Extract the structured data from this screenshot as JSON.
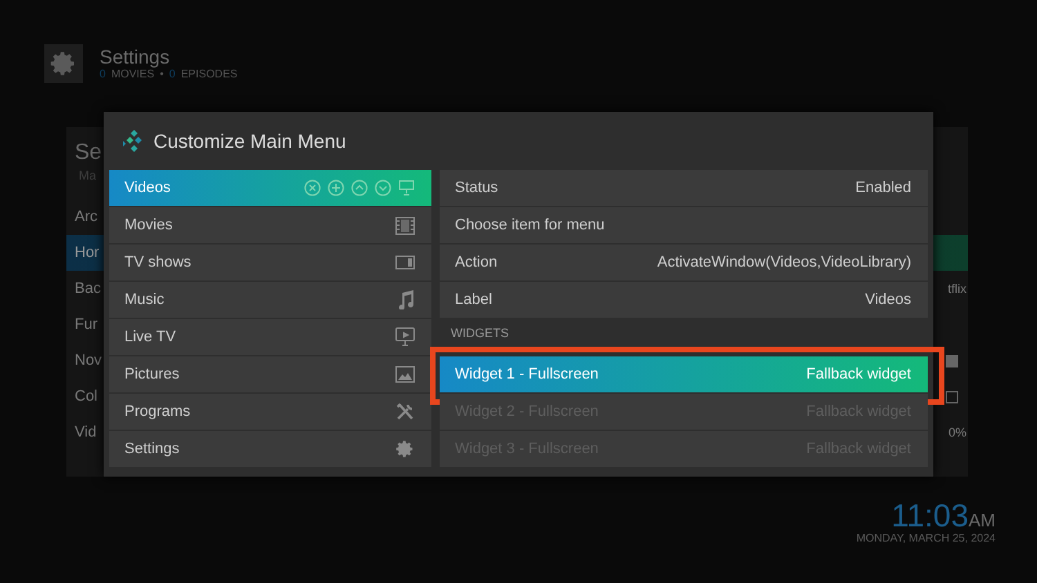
{
  "header": {
    "title": "Settings",
    "counts": [
      {
        "count": "0",
        "label": "MOVIES"
      },
      {
        "count": "0",
        "label": "EPISODES"
      }
    ],
    "separator": "•"
  },
  "background_panel": {
    "title": "Se",
    "subtitle": "Ma",
    "rows": [
      {
        "label": "Arc",
        "selected": false
      },
      {
        "label": "Hor",
        "selected": true
      },
      {
        "label": "Bac",
        "selected": false,
        "kind": "text",
        "value": "tflix"
      },
      {
        "label": "Fur",
        "selected": false
      },
      {
        "label": "Nov",
        "selected": false,
        "kind": "checkbox",
        "checked": true
      },
      {
        "label": "Col",
        "selected": false,
        "kind": "checkbox",
        "checked": false
      },
      {
        "label": "Vid",
        "selected": false,
        "kind": "text",
        "value": "0%"
      }
    ]
  },
  "dialog": {
    "title": "Customize Main Menu",
    "menu_items": [
      {
        "label": "Videos",
        "selected": true
      },
      {
        "label": "Movies",
        "selected": false
      },
      {
        "label": "TV shows",
        "selected": false
      },
      {
        "label": "Music",
        "selected": false
      },
      {
        "label": "Live TV",
        "selected": false
      },
      {
        "label": "Pictures",
        "selected": false
      },
      {
        "label": "Programs",
        "selected": false
      },
      {
        "label": "Settings",
        "selected": false
      }
    ],
    "properties": [
      {
        "kind": "setting",
        "label": "Status",
        "value": "Enabled"
      },
      {
        "kind": "setting",
        "label": "Choose item for menu"
      },
      {
        "kind": "setting",
        "label": "Action",
        "value": "ActivateWindow(Videos,VideoLibrary)"
      },
      {
        "kind": "setting",
        "label": "Label",
        "value": "Videos"
      },
      {
        "kind": "heading",
        "label": "WIDGETS"
      },
      {
        "kind": "widget",
        "label": "Widget 1 - Fullscreen",
        "value": "Fallback widget",
        "selected": true,
        "disabled": false,
        "annotated": true
      },
      {
        "kind": "widget",
        "label": "Widget 2 - Fullscreen",
        "value": "Fallback widget",
        "selected": false,
        "disabled": true,
        "annotated": false
      },
      {
        "kind": "widget",
        "label": "Widget 3 - Fullscreen",
        "value": "Fallback widget",
        "selected": false,
        "disabled": true,
        "annotated": false
      }
    ]
  },
  "clock": {
    "time": "11:03",
    "ampm": "AM",
    "date": "MONDAY, MARCH 25, 2024"
  }
}
